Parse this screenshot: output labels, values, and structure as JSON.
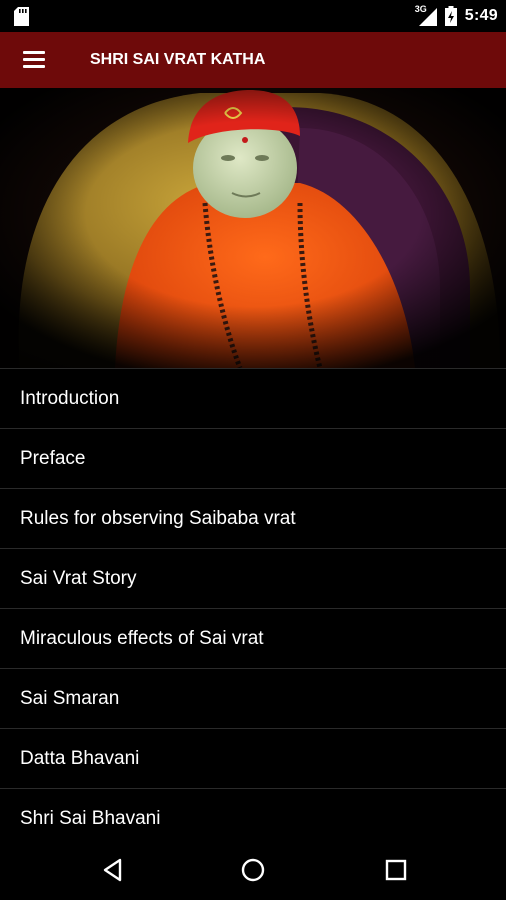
{
  "status_bar": {
    "time": "5:49",
    "network": "3G",
    "icons": [
      "sd-card-icon",
      "cellular-signal-icon",
      "battery-icon"
    ]
  },
  "app_bar": {
    "title": "SHRI SAI VRAT KATHA",
    "icon": "hamburger-menu-icon",
    "color": "#6e0a0a"
  },
  "hero": {
    "image": "sai-baba-idol-photo"
  },
  "menu": {
    "items": [
      {
        "label": "Introduction"
      },
      {
        "label": "Preface"
      },
      {
        "label": "Rules for observing Saibaba vrat"
      },
      {
        "label": "Sai Vrat Story"
      },
      {
        "label": "Miraculous effects of Sai vrat"
      },
      {
        "label": "Sai Smaran"
      },
      {
        "label": "Datta Bhavani"
      },
      {
        "label": "Shri Sai Bhavani"
      }
    ]
  },
  "nav_bar": {
    "icons": [
      "back-icon",
      "home-icon",
      "recents-icon"
    ]
  }
}
